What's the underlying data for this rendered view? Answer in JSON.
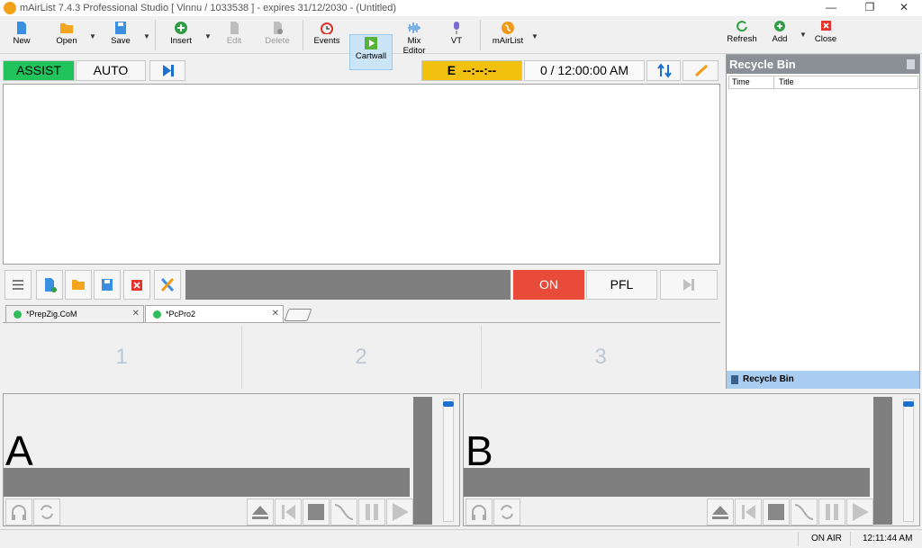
{
  "window": {
    "title": "mAirList 7.4.3 Professional Studio [ Vinnu / 1033538 ] - expires 31/12/2030 - (Untitled)",
    "minimize": "—",
    "restore": "❐",
    "close": "✕"
  },
  "toolbar": {
    "new": "New",
    "open": "Open",
    "save": "Save",
    "insert": "Insert",
    "edit": "Edit",
    "delete": "Delete",
    "events": "Events",
    "cartwall": "Cartwall",
    "mix_editor": "Mix Editor",
    "vt": "VT",
    "mairlist": "mAirList",
    "refresh": "Refresh",
    "add": "Add",
    "close": "Close"
  },
  "mode": {
    "assist": "ASSIST",
    "auto": "AUTO",
    "eta": "E  --:--:--",
    "clock": "0 / 12:00:00 AM"
  },
  "cart": {
    "on": "ON",
    "pfl": "PFL"
  },
  "tabs": [
    {
      "label": "*PrepZig.CoM"
    },
    {
      "label": "*PcPro2"
    }
  ],
  "slots": [
    "1",
    "2",
    "3"
  ],
  "players": [
    {
      "letter": "A"
    },
    {
      "letter": "B"
    }
  ],
  "recycle": {
    "title": "Recycle Bin",
    "col_time": "Time",
    "col_title": "Title",
    "footer": "Recycle Bin"
  },
  "status": {
    "on_air": "ON AIR",
    "time": "12:11:44 AM"
  },
  "colors": {
    "assist": "#21c45a",
    "eta": "#f2c00f",
    "on": "#e84b3a",
    "meter": "#7f7f7f",
    "accent": "#1a6fd0"
  }
}
